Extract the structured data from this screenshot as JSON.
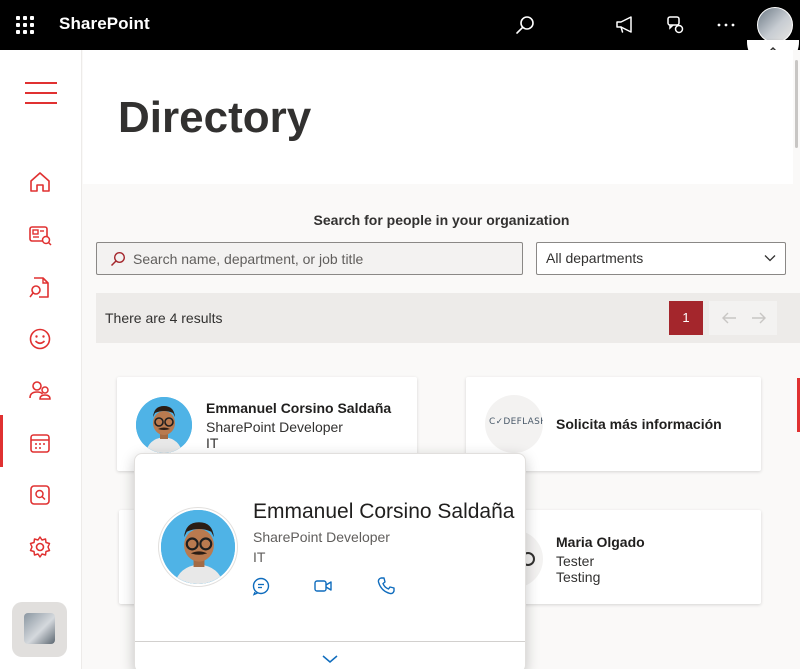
{
  "app": {
    "name": "SharePoint"
  },
  "topbar_icons": [
    "waffle-icon",
    "search-icon",
    "megaphone-icon",
    "chat-settings-icon",
    "more-icon",
    "user-avatar"
  ],
  "rail": {
    "items": [
      {
        "name": "home-icon"
      },
      {
        "name": "news-icon"
      },
      {
        "name": "document-search-icon"
      },
      {
        "name": "emoji-icon"
      },
      {
        "name": "people-icon",
        "active": true
      },
      {
        "name": "calendar-icon"
      },
      {
        "name": "search-box-icon"
      },
      {
        "name": "settings-icon"
      }
    ]
  },
  "page": {
    "title": "Directory"
  },
  "search": {
    "heading": "Search for people in your organization",
    "placeholder": "Search name, department, or job title",
    "department_selected": "All departments"
  },
  "results": {
    "text": "There are 4 results",
    "current_page": "1"
  },
  "cards": {
    "emmanuel": {
      "name": "Emmanuel Corsino Saldaña",
      "title": "SharePoint Developer",
      "department": "IT"
    },
    "codeflash": {
      "logo_text": "C✓DEFLASH",
      "name": "Solicita más información"
    },
    "maria": {
      "name": "Maria Olgado",
      "title": "Tester",
      "department": "Testing"
    }
  },
  "popup": {
    "name": "Emmanuel Corsino Saldaña",
    "title": "SharePoint Developer",
    "department": "IT",
    "actions": [
      "chat-icon",
      "video-call-icon",
      "phone-icon"
    ]
  },
  "colors": {
    "accent": "#e03131",
    "page_button": "#a4262c",
    "topbar": "#000000"
  }
}
